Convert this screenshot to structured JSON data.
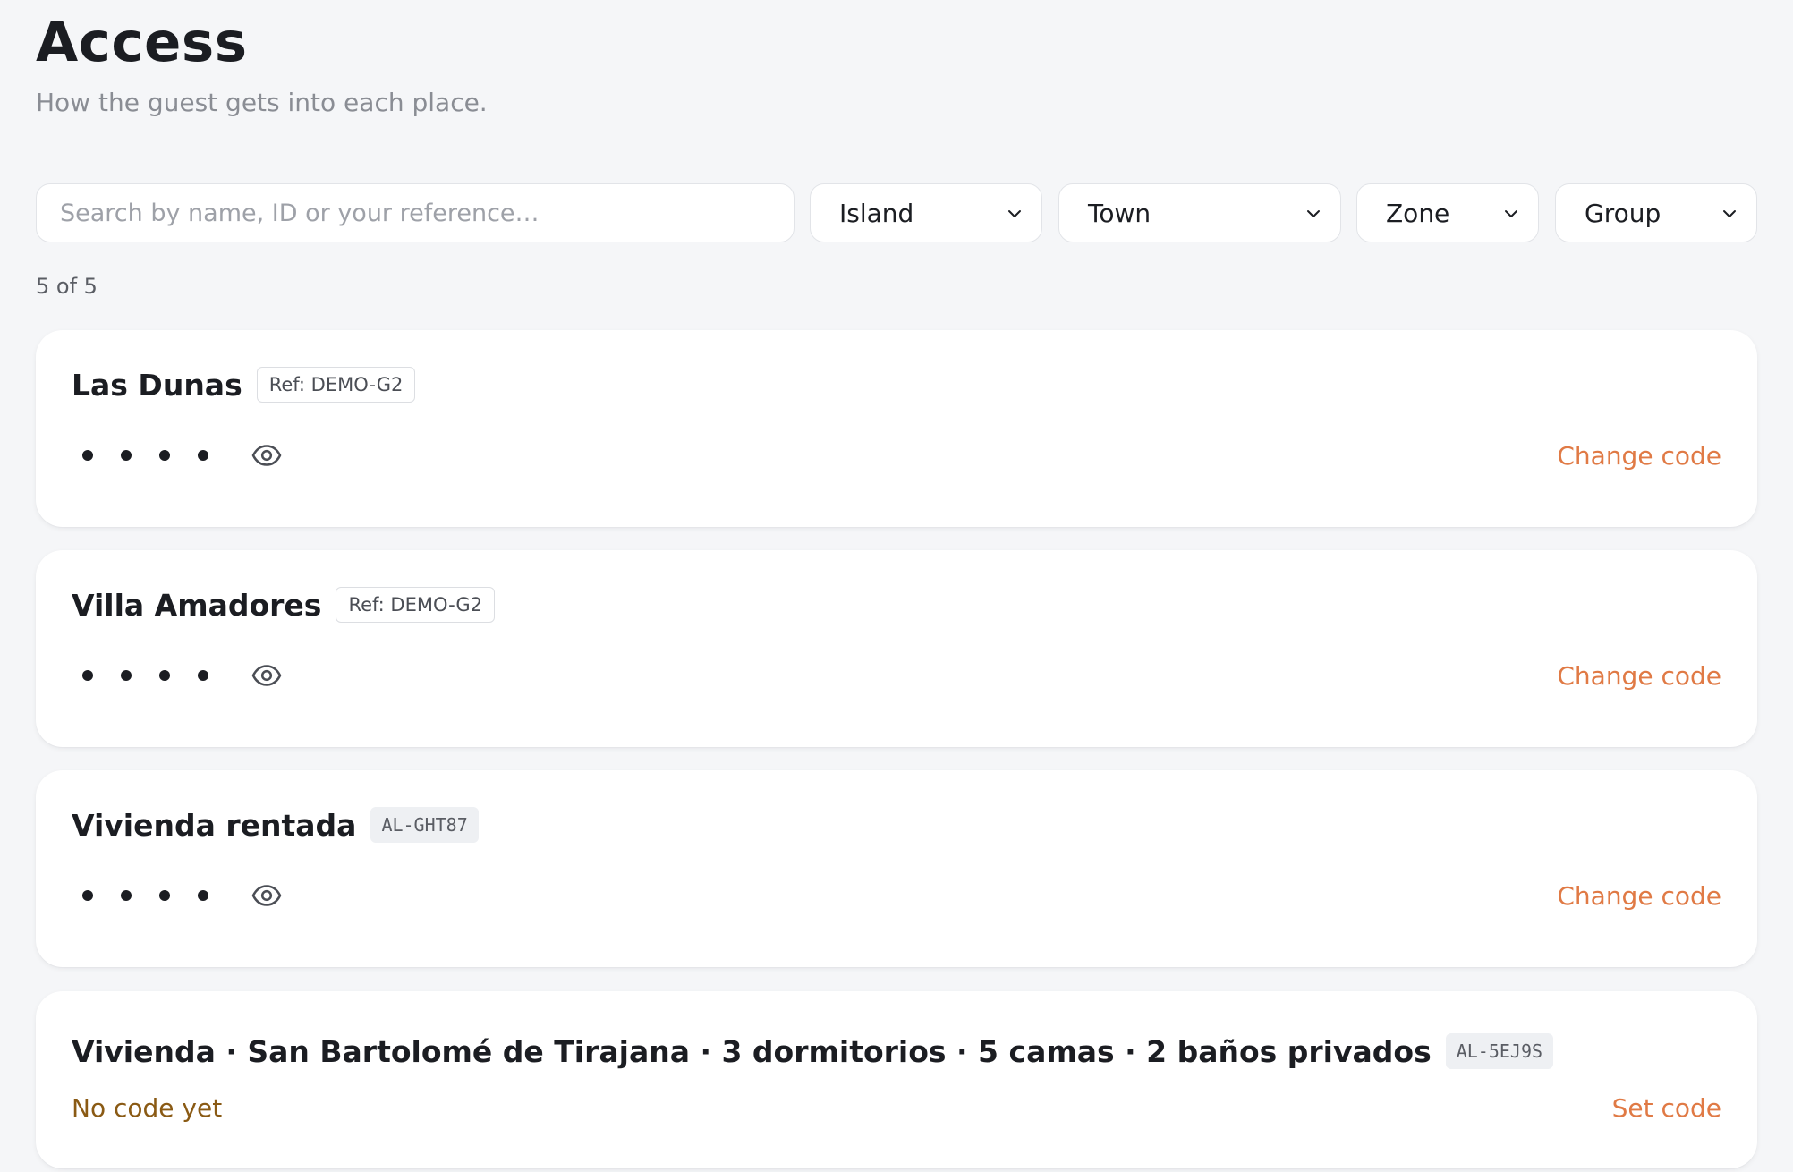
{
  "header": {
    "title": "Access",
    "subtitle": "How the guest gets into each place."
  },
  "filters": {
    "search_placeholder": "Search by name, ID or your reference…",
    "search_value": "",
    "island_label": "Island",
    "town_label": "Town",
    "zone_label": "Zone",
    "group_label": "Group"
  },
  "results": {
    "count_label": "5 of 5"
  },
  "icons": {
    "reveal": "eye-icon",
    "dropdown": "chevron-down-icon"
  },
  "colors": {
    "action": "#e07a45",
    "warning": "#8a5a14",
    "background": "#f5f6f8"
  },
  "cards": [
    {
      "name": "Las Dunas",
      "tag": "Ref: DEMO-G2",
      "masked_code": "••••",
      "action_label": "Change code"
    },
    {
      "name": "Villa Amadores",
      "tag": "Ref: DEMO-G2",
      "masked_code": "••••",
      "action_label": "Change code"
    },
    {
      "name": "Vivienda rentada",
      "tag": "AL-GHT87",
      "masked_code": "••••",
      "action_label": "Change code"
    },
    {
      "name": "Vivienda · San Bartolomé de Tirajana · 3 dormitorios · 5 camas · 2 baños privados",
      "tag": "AL-5EJ9S",
      "status": "No code yet",
      "action_label": "Set code"
    }
  ]
}
